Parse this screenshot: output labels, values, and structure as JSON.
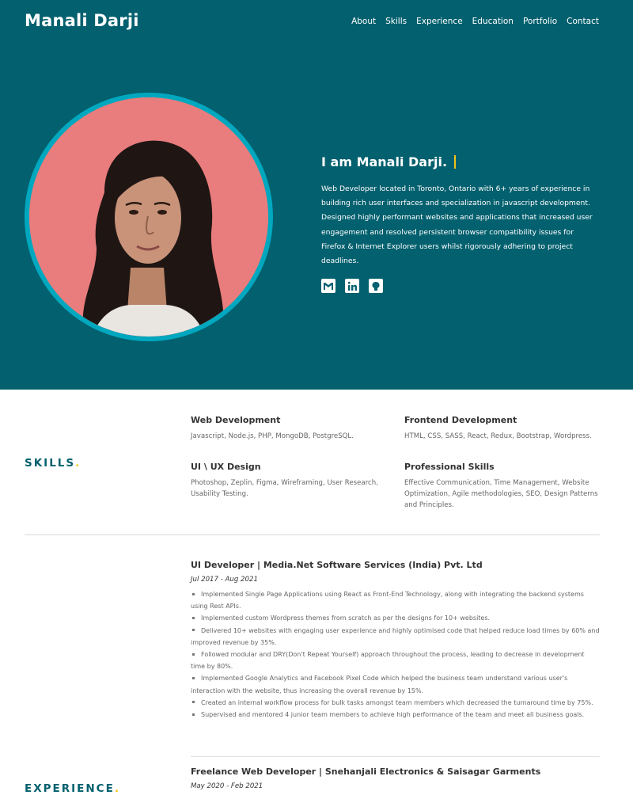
{
  "header": {
    "brand": "Manali Darji",
    "nav": [
      "About",
      "Skills",
      "Experience",
      "Education",
      "Portfolio",
      "Contact"
    ]
  },
  "hero": {
    "heading": "I am Manali Darji.",
    "bio": "Web Developer located in Toronto, Ontario with 6+ years of experience in building rich user interfaces and specialization in javascript development. Designed highly performant websites and applications that increased user engagement and resolved persistent browser compatibility issues for Firefox & Internet Explorer users whilst rigorously adhering to project deadlines.",
    "socials": [
      "gmail-icon",
      "linkedin-icon",
      "github-icon"
    ]
  },
  "skills": {
    "title": "SKILLS",
    "dot": ".",
    "items": [
      {
        "title": "Web Development",
        "text": "Javascript, Node.js, PHP, MongoDB, PostgreSQL."
      },
      {
        "title": "Frontend Development",
        "text": "HTML, CSS, SASS, React, Redux, Bootstrap, Wordpress."
      },
      {
        "title": "UI \\ UX Design",
        "text": "Photoshop, Zeplin, Figma, Wireframing, User Research, Usability Testing."
      },
      {
        "title": "Professional Skills",
        "text": "Effective Communication, Time Management, Website Optimization, Agile methodologies, SEO, Design Patterns and Principles."
      }
    ]
  },
  "experience": {
    "title": "EXPERIENCE",
    "dot": ".",
    "jobs": [
      {
        "title": "UI Developer | Media.Net Software Services (India) Pvt. Ltd",
        "dates": "Jul 2017 - Aug 2021",
        "bullets": [
          "Implemented Single Page Applications using React as Front-End Technology, along with integrating the backend systems using Rest APIs.",
          "Implemented custom Wordpress themes from scratch as per the designs for 10+ websites.",
          "Delivered 10+ websites with engaging user experience and highly optimised code that helped reduce load times by 60% and improved revenue by 35%.",
          "Followed modular and DRY(Don't Repeat Yourself) approach throughout the process, leading to decrease in development time by 80%.",
          "Implemented Google Analytics and Facebook Pixel Code which helped the business team understand various user's interaction with the website, thus increasing the overall revenue by 15%.",
          "Created an internal workflow process for bulk tasks amongst team members which decreased the turnaround time by 75%.",
          "Supervised and mentored 4 junior team members to achieve high performance of the team and meet all business goals."
        ]
      },
      {
        "title": "Freelance Web Developer | Snehanjali Electronics & Saisagar Garments",
        "dates": "May 2020 - Feb 2021"
      }
    ]
  },
  "colors": {
    "hero_bg": "#03606e",
    "accent": "#f5c518",
    "ring": "#00a8bf",
    "avatar_bg": "#e97c7c"
  }
}
